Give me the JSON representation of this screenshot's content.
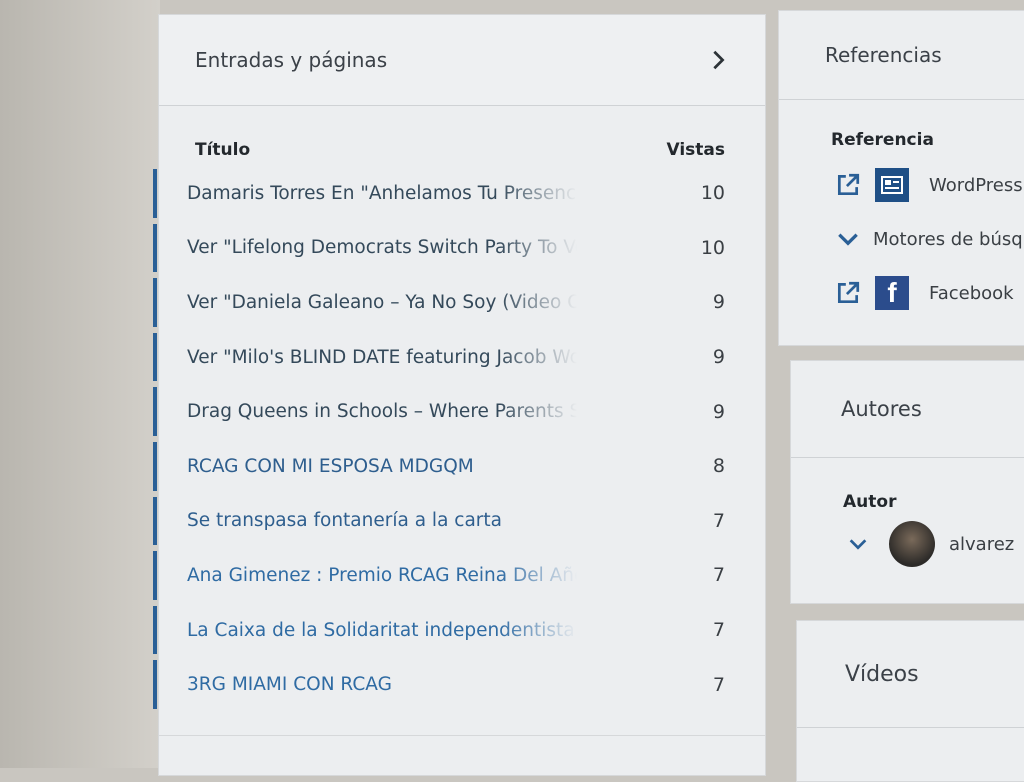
{
  "posts_card": {
    "title": "Entradas y páginas",
    "col_title": "Título",
    "col_views": "Vistas",
    "rows": [
      {
        "title": "Damaris Torres En \"Anhelamos Tu Presencia\"",
        "views": "10"
      },
      {
        "title": "Ver \"Lifelong Democrats Switch Party To Vote\"",
        "views": "10"
      },
      {
        "title": "Ver \"Daniela Galeano – Ya No Soy (Video Oficial)\"",
        "views": "9"
      },
      {
        "title": "Ver \"Milo's BLIND DATE featuring Jacob Wohl\"",
        "views": "9"
      },
      {
        "title": "Drag Queens in Schools – Where Parents Stand",
        "views": "9"
      },
      {
        "title": "RCAG CON MI ESPOSA MDGQM",
        "views": "8"
      },
      {
        "title": "Se transpasa fontanería a la carta",
        "views": "7"
      },
      {
        "title": "Ana Gimenez : Premio RCAG Reina Del Año",
        "views": "7"
      },
      {
        "title": "La Caixa de la Solidaritat independentista",
        "views": "7"
      },
      {
        "title": "3RG MIAMI CON RCAG",
        "views": "7"
      }
    ]
  },
  "referrers_card": {
    "title": "Referencias",
    "col_title": "Referencia",
    "items": [
      {
        "label": "WordPress",
        "icon": "external-link-icon"
      },
      {
        "label": "Motores de búsqueda",
        "icon": "chevron-down-icon"
      },
      {
        "label": "Facebook",
        "icon": "external-link-icon"
      }
    ]
  },
  "authors_card": {
    "title": "Autores",
    "col_title": "Autor",
    "author_name": "alvarez"
  },
  "videos_card": {
    "title": "Vídeos"
  },
  "colors": {
    "accent_bar": "#2a5f96",
    "link_blue": "#2e5e8e",
    "facebook_blue": "#2b4c8c"
  }
}
